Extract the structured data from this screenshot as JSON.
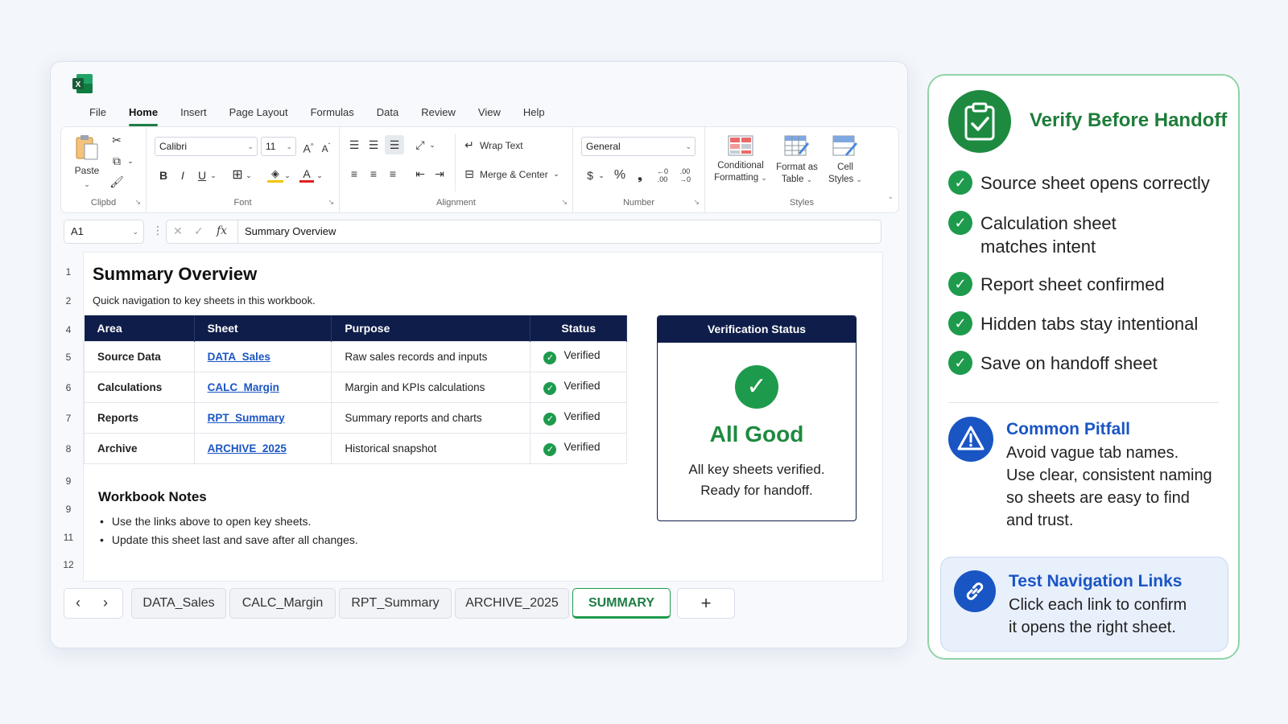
{
  "menu": [
    "File",
    "Home",
    "Insert",
    "Page Layout",
    "Formulas",
    "Data",
    "Review",
    "View",
    "Help"
  ],
  "ribbon": {
    "paste_label": "Paste",
    "clipboard_label": "Clipbd",
    "font_name": "Calibri",
    "font_size": "11",
    "font_label": "Font",
    "wrap_text": "Wrap Text",
    "merge_center": "Merge & Center",
    "alignment_label": "Alignment",
    "number_format": "General",
    "number_label": "Number",
    "cond_format_1": "Conditional",
    "cond_format_2": "Formatting",
    "format_table_1": "Format as",
    "format_table_2": "Table",
    "cell_styles_1": "Cell",
    "cell_styles_2": "Styles",
    "styles_label": "Styles"
  },
  "formula_bar": {
    "name_box": "A1",
    "fx": "fx",
    "value": "Summary Overview"
  },
  "row_numbers": [
    "1",
    "2",
    "4",
    "5",
    "6",
    "7",
    "8",
    "9",
    "9",
    "11",
    "12"
  ],
  "sheet": {
    "title": "Summary Overview",
    "subtitle": "Quick navigation to key sheets in this workbook.",
    "headers": [
      "Area",
      "Sheet",
      "Purpose",
      "Status"
    ],
    "rows": [
      {
        "area": "Source Data",
        "sheet": "DATA_Sales",
        "purpose": "Raw sales records and inputs",
        "status": "Verified"
      },
      {
        "area": "Calculations",
        "sheet": "CALC_Margin",
        "purpose": "Margin and KPIs calculations",
        "status": "Verified"
      },
      {
        "area": "Reports",
        "sheet": "RPT_Summary",
        "purpose": "Summary reports and charts",
        "status": "Verified"
      },
      {
        "area": "Archive",
        "sheet": "ARCHIVE_2025",
        "purpose": "Historical snapshot",
        "status": "Verified"
      }
    ],
    "verification": {
      "title": "Verification Status",
      "headline": "All Good",
      "line1": "All key sheets verified.",
      "line2": "Ready for handoff."
    },
    "notes_title": "Workbook Notes",
    "notes": [
      "Use the links above to open key sheets.",
      "Update this sheet last and save after all changes."
    ]
  },
  "tabs": [
    "DATA_Sales",
    "CALC_Margin",
    "RPT_Summary",
    "ARCHIVE_2025",
    "SUMMARY"
  ],
  "tab_add": "+",
  "panel": {
    "title": "Verify Before Handoff",
    "checks": [
      [
        "Source sheet opens correctly"
      ],
      [
        "Calculation sheet",
        "matches intent"
      ],
      [
        "Report sheet confirmed"
      ],
      [
        "Hidden tabs stay intentional"
      ],
      [
        "Save on handoff sheet"
      ]
    ],
    "pitfall_title": "Common Pitfall",
    "pitfall_lines": [
      "Avoid vague tab names.",
      "Use clear, consistent naming",
      "so sheets are easy to find",
      "and trust."
    ],
    "tip_title": "Test Navigation Links",
    "tip_lines": [
      "Click each link to confirm",
      "it opens the right sheet."
    ]
  },
  "colors": {
    "excel_green": "#1e7d45",
    "navy": "#0f1d4a",
    "link_blue": "#1a55c4",
    "ok_green": "#1e9a4c"
  }
}
